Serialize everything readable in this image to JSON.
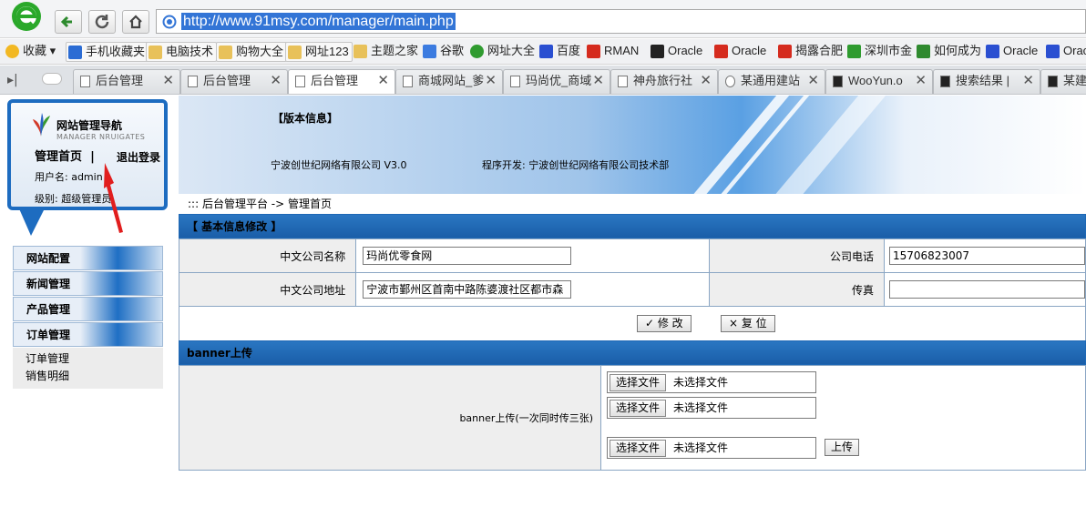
{
  "browser": {
    "url": "http://www.91msy.com/manager/main.php",
    "bookmarks": [
      "收藏",
      "手机收藏夹",
      "电脑技术",
      "购物大全",
      "网址123",
      "主题之家",
      "谷歌",
      "网址大全",
      "百度",
      "RMAN",
      "Oracle",
      "Oracle",
      "揭露合肥",
      "深圳市金",
      "如何成为",
      "Oracle",
      "Orac"
    ],
    "tabs": [
      "后台管理",
      "后台管理",
      "后台管理",
      "商城网站_爹",
      "玛尚优_商域",
      "神舟旅行社",
      "某通用建站",
      "WooYun.o",
      "搜索结果 |",
      "某建站"
    ]
  },
  "nav": {
    "title": "网站管理导航",
    "subtitle": "MANAGER NRUIGATES",
    "home": "管理首页",
    "separator": "|",
    "logout": "退出登录",
    "username": "用户名: admin",
    "level": "级别: 超级管理员"
  },
  "menu": {
    "items": [
      "网站配置",
      "新闻管理",
      "产品管理",
      "订单管理"
    ],
    "sub_items": [
      "订单管理",
      "销售明细"
    ]
  },
  "banner": {
    "title": "【版本信息】",
    "company": "宁波创世纪网络有限公司 V3.0",
    "developer": "程序开发: 宁波创世纪网络有限公司技术部"
  },
  "breadcrumb": "::: 后台管理平台 -> 管理首页",
  "form": {
    "section_title": "【 基本信息修改 】",
    "cn_name_label": "中文公司名称",
    "cn_name_value": "玛尚优零食网",
    "phone_label": "公司电话",
    "phone_value": "15706823007",
    "address_label": "中文公司地址",
    "address_value": "宁波市鄞州区首南中路陈婆渡社区都市森",
    "fax_label": "传真",
    "fax_value": "",
    "modify_button": "✓ 修 改",
    "reset_button": "× 复 位"
  },
  "banner_upload": {
    "section_title": "banner上传",
    "label": "banner上传(一次同时传三张)",
    "choose_file": "选择文件",
    "no_file": "未选择文件",
    "upload_button": "上传"
  },
  "colors": {
    "accent_blue": "#1e68b5",
    "label_bg": "#eeeeee",
    "url_highlight": "#3375d6"
  }
}
